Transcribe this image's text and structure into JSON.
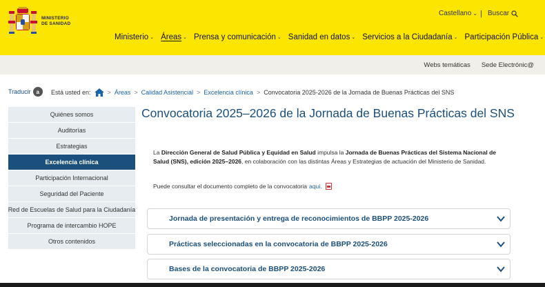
{
  "header": {
    "logo_line1": "MINISTERIO",
    "logo_line2": "DE SANIDAD",
    "language": "Castellano",
    "search": "Buscar",
    "nav": [
      {
        "label": "Ministerio"
      },
      {
        "label": "Áreas"
      },
      {
        "label": "Prensa y comunicación"
      },
      {
        "label": "Sanidad en datos"
      },
      {
        "label": "Servicios a la Ciudadanía"
      },
      {
        "label": "Participación Pública"
      }
    ]
  },
  "subbar": {
    "webs": "Webs temáticas",
    "sede": "Sede Electrónic@"
  },
  "translate": {
    "label": "Traducir",
    "badge": "a"
  },
  "breadcrumb": {
    "prefix": "Está usted en:",
    "items": [
      "Áreas",
      "Calidad Asistencial",
      "Excelencia clínica"
    ],
    "current": "Convocatoria 2025-2026 de la Jornada de Buenas Prácticas del SNS",
    "separator": ">"
  },
  "sidebar": {
    "items": [
      {
        "label": "Quiénes somos"
      },
      {
        "label": "Auditorías"
      },
      {
        "label": "Estrategias"
      },
      {
        "label": "Excelencia clínica"
      },
      {
        "label": "Participación Internacional"
      },
      {
        "label": "Seguridad del Paciente"
      },
      {
        "label": "Red de Escuelas de Salud para la Ciudadanía"
      },
      {
        "label": "Programa de intercambio HOPE"
      },
      {
        "label": "Otros contenidos"
      }
    ]
  },
  "main": {
    "title": "Convocatoria 2025–2026 de la Jornada de Buenas Prácticas del SNS",
    "intro": {
      "t1": "La ",
      "b1": "Dirección General de Salud Pública y Equidad en Salud",
      "t2": " impulsa la ",
      "b2": "Jornada de Buenas Prácticas del Sistema Nacional de Salud (SNS), edición 2025–2026",
      "t3": ", en colaboración con las distintas Áreas y Estrategias de actuación del Ministerio de Sanidad."
    },
    "note_text": "Puede consultar el documento completo de la convocatoria",
    "note_link": "aquí.",
    "accordions": [
      {
        "title": "Jornada de presentación y entrega de reconocimientos de BBPP 2025-2026"
      },
      {
        "title": "Prácticas seleccionadas en la convocatoria de BBPP 2025-2026"
      },
      {
        "title": "Bases de la convocatoria de BBPP 2025-2026"
      }
    ]
  },
  "colors": {
    "header_yellow": "#fce500",
    "primary_blue": "#1b4f7c",
    "sidebar_bg": "#e6ecef",
    "link_blue": "#1a63a8"
  }
}
